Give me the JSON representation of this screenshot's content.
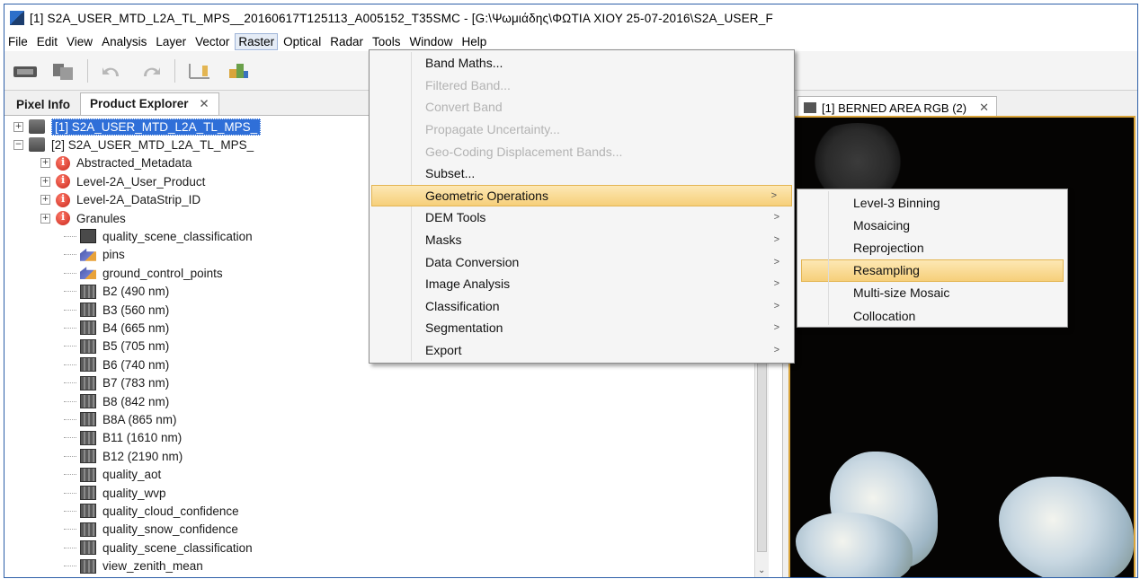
{
  "window": {
    "title": "[1] S2A_USER_MTD_L2A_TL_MPS__20160617T125113_A005152_T35SMC - [G:\\Ψωμιάδης\\ΦΩΤΙΑ ΧΙΟΥ 25-07-2016\\S2A_USER_F"
  },
  "menubar": {
    "items": [
      "File",
      "Edit",
      "View",
      "Analysis",
      "Layer",
      "Vector",
      "Raster",
      "Optical",
      "Radar",
      "Tools",
      "Window",
      "Help"
    ],
    "active": "Raster"
  },
  "toolbar": {
    "icons": [
      "open-product-icon",
      "product-library-icon",
      "undo-icon",
      "redo-icon",
      "band-maths-icon",
      "scatter-plot-icon",
      "world-map-icon",
      "layer-manager-icon",
      "spectrum-view-icon",
      "profile-plot-icon",
      "statistics-sum-icon",
      "gcp-manager-icon"
    ]
  },
  "left_panel": {
    "tabs": [
      {
        "label": "Pixel Info",
        "selected": false
      },
      {
        "label": "Product Explorer",
        "selected": true,
        "close": "✕"
      }
    ],
    "tree": [
      {
        "label": "[1] S2A_USER_MTD_L2A_TL_MPS_",
        "type": "product",
        "expander": "+",
        "selected": true
      },
      {
        "label": "[2] S2A_USER_MTD_L2A_TL_MPS_",
        "type": "product",
        "expander": "−"
      },
      {
        "label": "Abstracted_Metadata",
        "type": "metadata",
        "expander": "+"
      },
      {
        "label": "Level-2A_User_Product",
        "type": "metadata",
        "expander": "+"
      },
      {
        "label": "Level-2A_DataStrip_ID",
        "type": "metadata",
        "expander": "+"
      },
      {
        "label": "Granules",
        "type": "metadata",
        "expander": "+"
      },
      {
        "label": "quality_scene_classification",
        "type": "scene"
      },
      {
        "label": "pins",
        "type": "pin"
      },
      {
        "label": "ground_control_points",
        "type": "pin"
      },
      {
        "label": "B2 (490 nm)",
        "type": "band"
      },
      {
        "label": "B3 (560 nm)",
        "type": "band"
      },
      {
        "label": "B4 (665 nm)",
        "type": "band"
      },
      {
        "label": "B5 (705 nm)",
        "type": "band"
      },
      {
        "label": "B6 (740 nm)",
        "type": "band"
      },
      {
        "label": "B7 (783 nm)",
        "type": "band"
      },
      {
        "label": "B8 (842 nm)",
        "type": "band"
      },
      {
        "label": "B8A (865 nm)",
        "type": "band"
      },
      {
        "label": "B11 (1610 nm)",
        "type": "band"
      },
      {
        "label": "B12 (2190 nm)",
        "type": "band"
      },
      {
        "label": "quality_aot",
        "type": "band"
      },
      {
        "label": "quality_wvp",
        "type": "band"
      },
      {
        "label": "quality_cloud_confidence",
        "type": "band"
      },
      {
        "label": "quality_snow_confidence",
        "type": "band"
      },
      {
        "label": "quality_scene_classification",
        "type": "band"
      },
      {
        "label": "view_zenith_mean",
        "type": "band"
      }
    ]
  },
  "image_view": {
    "tab_label": "[1] BERNED AREA RGB (2)",
    "close": "✕"
  },
  "raster_menu": {
    "items": [
      {
        "label": "Band Maths...",
        "enabled": true,
        "submenu": false
      },
      {
        "label": "Filtered Band...",
        "enabled": false,
        "submenu": false
      },
      {
        "label": "Convert Band",
        "enabled": false,
        "submenu": false
      },
      {
        "label": "Propagate Uncertainty...",
        "enabled": false,
        "submenu": false
      },
      {
        "label": "Geo-Coding Displacement Bands...",
        "enabled": false,
        "submenu": false
      },
      {
        "label": "Subset...",
        "enabled": true,
        "submenu": false
      },
      {
        "label": "Geometric Operations",
        "enabled": true,
        "submenu": true,
        "highlight": true
      },
      {
        "label": "DEM Tools",
        "enabled": true,
        "submenu": true
      },
      {
        "label": "Masks",
        "enabled": true,
        "submenu": true
      },
      {
        "label": "Data Conversion",
        "enabled": true,
        "submenu": true
      },
      {
        "label": "Image Analysis",
        "enabled": true,
        "submenu": true
      },
      {
        "label": "Classification",
        "enabled": true,
        "submenu": true
      },
      {
        "label": "Segmentation",
        "enabled": true,
        "submenu": true
      },
      {
        "label": "Export",
        "enabled": true,
        "submenu": true
      }
    ],
    "arrow": ">"
  },
  "geometric_submenu": {
    "items": [
      {
        "label": "Level-3 Binning",
        "highlight": false
      },
      {
        "label": "Mosaicing",
        "highlight": false
      },
      {
        "label": "Reprojection",
        "highlight": false
      },
      {
        "label": "Resampling",
        "highlight": true
      },
      {
        "label": "Multi-size Mosaic",
        "highlight": false
      },
      {
        "label": "Collocation",
        "highlight": false
      }
    ]
  },
  "colors": {
    "menu_highlight": "#f6cf7a",
    "selection": "#2f6fd8",
    "canvas_border": "#d9a43a"
  }
}
